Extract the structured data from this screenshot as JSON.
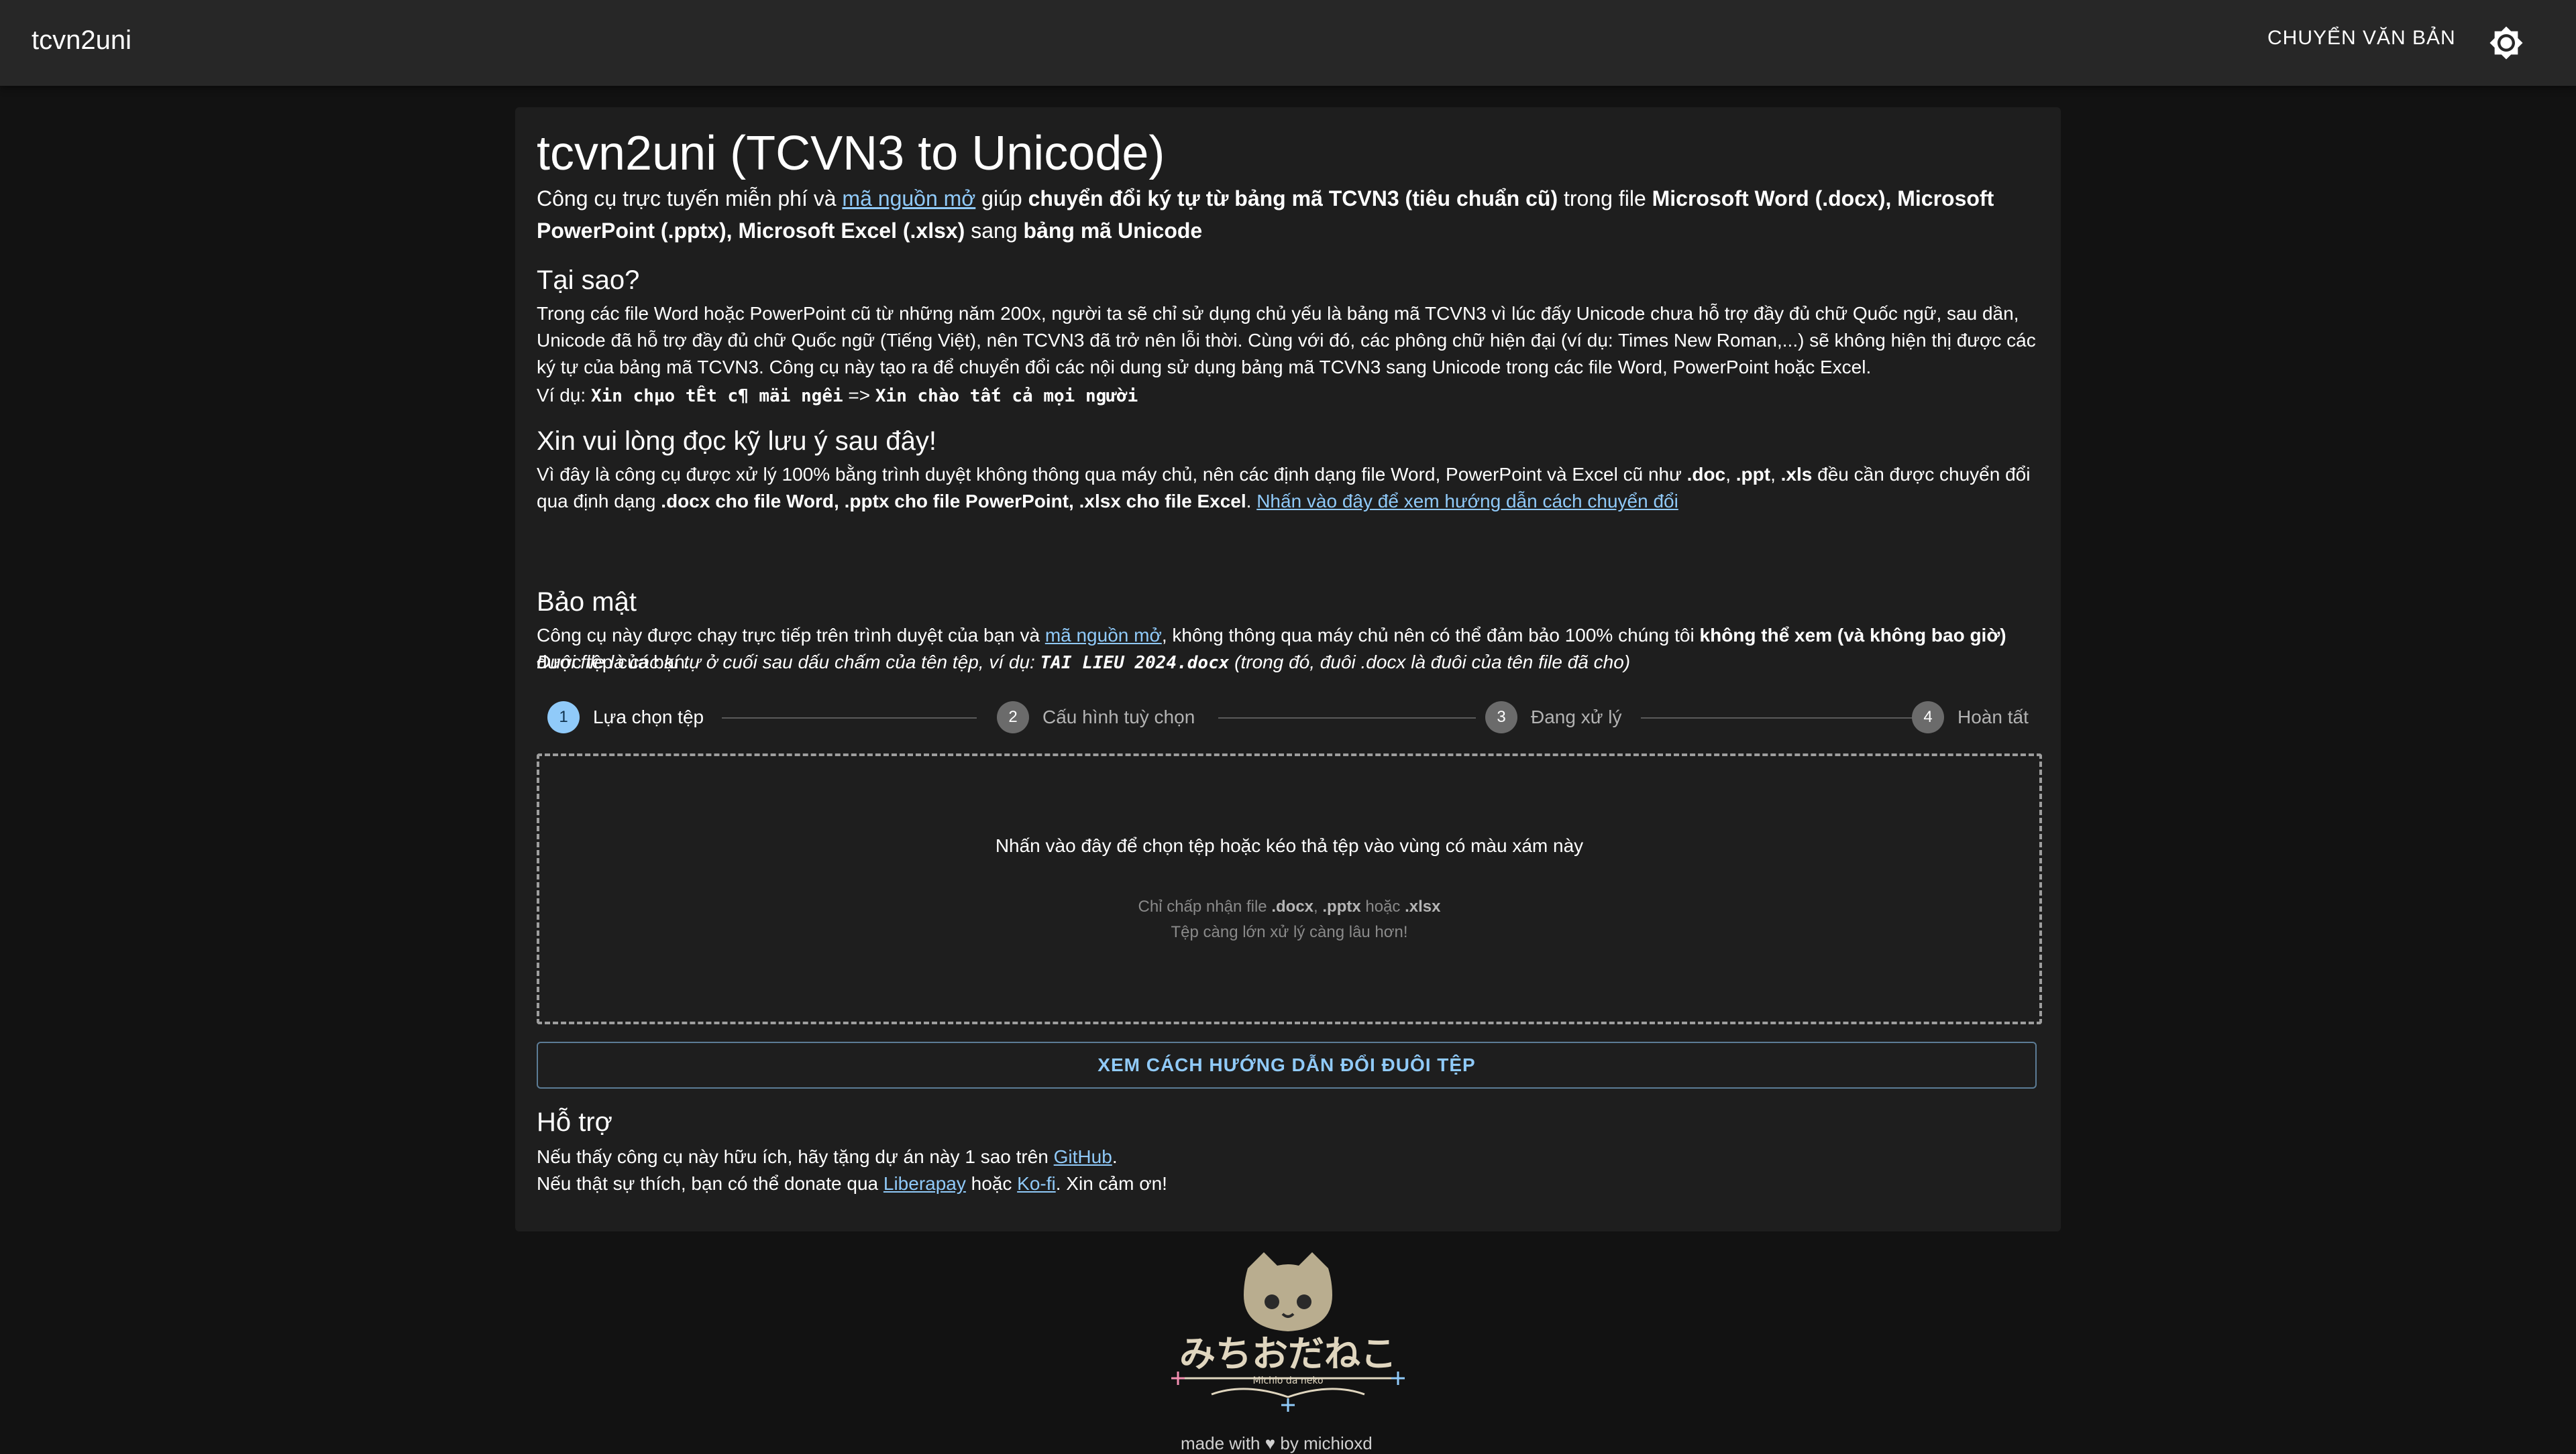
{
  "appbar": {
    "brand": "tcvn2uni",
    "nav_button": "CHUYỂN VĂN BẢN"
  },
  "header": {
    "title": "tcvn2uni (TCVN3 to Unicode)",
    "lead_prefix": "Công cụ trực tuyến miễn phí và",
    "lead_link": "mã nguồn mở",
    "lead_mid": "giúp",
    "lead_bold1": "chuyển đổi ký tự từ bảng mã TCVN3 (tiêu chuẩn cũ)",
    "lead_mid2": "trong file",
    "lead_bold2": "Microsoft Word (.docx), Microsoft PowerPoint (.pptx), Microsoft Excel (.xlsx)",
    "lead_mid3": "sang",
    "lead_bold3": "bảng mã Unicode"
  },
  "why": {
    "heading": "Tại sao?",
    "body": "Trong các file Word hoặc PowerPoint cũ từ những năm 200x, người ta sẽ chỉ sử dụng chủ yếu là bảng mã TCVN3 vì lúc đấy Unicode chưa hỗ trợ đầy đủ chữ Quốc ngữ, sau dần, Unicode đã hỗ trợ đầy đủ chữ Quốc ngữ (Tiếng Việt), nên TCVN3 đã trở nên lỗi thời. Cùng với đó, các phông chữ hiện đại (ví dụ: Times New Roman,...) sẽ không hiện thị được các ký tự của bảng mã TCVN3. Công cụ này tạo ra để chuyển đổi các nội dung sử dụng bảng mã TCVN3 sang Unicode trong các file Word, PowerPoint hoặc Excel.",
    "example_label": "Ví dụ:",
    "example_before": "Xin chµo tÊt c¶ mäi ng­êi",
    "example_arrow": "=>",
    "example_after": "Xin chào tất cả mọi người"
  },
  "notice": {
    "heading": "Xin vui lòng đọc kỹ lưu ý sau đây!",
    "body_prefix": "Vì đây là công cụ được xử lý 100% bằng trình duyệt không thông qua máy chủ, nên các định dạng file Word, PowerPoint và Excel cũ như",
    "fmt1": ".doc",
    "sep1": ",",
    "fmt2": ".ppt",
    "sep2": ",",
    "fmt3": ".xls",
    "body_mid": "đều cần được chuyển đổi qua định dạng",
    "body_bold": ".docx cho file Word, .pptx cho file PowerPoint, .xlsx cho file Excel",
    "body_dot": ".",
    "guide_link": "Nhấn vào đây để xem hướng dẫn cách chuyển đổi",
    "ext_note_prefix": "Đuôi file là các kí tự ở cuối sau dấu chấm của tên tệp, ví dụ:",
    "ext_note_example": "TAI LIEU 2024.docx",
    "ext_note_suffix": "(trong đó, đuôi .docx là đuôi của tên file đã cho)"
  },
  "security": {
    "heading": "Bảo mật",
    "body_prefix": "Công cụ này được chạy trực tiếp trên trình duyệt của bạn và",
    "link": "mã nguồn mở",
    "body_mid": ", không thông qua máy chủ nên có thể đảm bảo 100% chúng tôi",
    "body_bold": "không thể xem (và không bao giờ)",
    "body_suffix": "được tệp của bạn."
  },
  "stepper": {
    "steps": [
      {
        "num": "1",
        "label": "Lựa chọn tệp"
      },
      {
        "num": "2",
        "label": "Cấu hình tuỳ chọn"
      },
      {
        "num": "3",
        "label": "Đang xử lý"
      },
      {
        "num": "4",
        "label": "Hoàn tất"
      }
    ]
  },
  "dropzone": {
    "main": "Nhấn vào đây để chọn tệp hoặc kéo thả tệp vào vùng có màu xám này",
    "accept_prefix": "Chỉ chấp nhận file",
    "accept_f1": ".docx",
    "accept_sep": ",",
    "accept_f2": ".pptx",
    "accept_or": "hoặc",
    "accept_f3": ".xlsx",
    "size_note": "Tệp càng lớn xử lý càng lâu hơn!"
  },
  "guide_button": "XEM CÁCH HƯỚNG DẪN ĐỔI ĐUÔI TỆP",
  "support": {
    "heading": "Hỗ trợ",
    "line1_prefix": "Nếu thấy công cụ này hữu ích, hãy tặng dự án này 1 sao trên",
    "github": "GitHub",
    "line1_suffix": ".",
    "line2_prefix": "Nếu thật sự thích, bạn có thể donate qua",
    "liberapay": "Liberapay",
    "or": "hoặc",
    "kofi": "Ko-fi",
    "line2_suffix": ". Xin cảm ơn!"
  },
  "footer": {
    "logo_text": "みちおだねこ",
    "logo_sub": "Michio da neko",
    "made_with": "made with ♥ by michioxd"
  },
  "colors": {
    "background": "#121212",
    "paper": "#1e1e1e",
    "appbar": "#272727",
    "accent": "#90caf9"
  }
}
